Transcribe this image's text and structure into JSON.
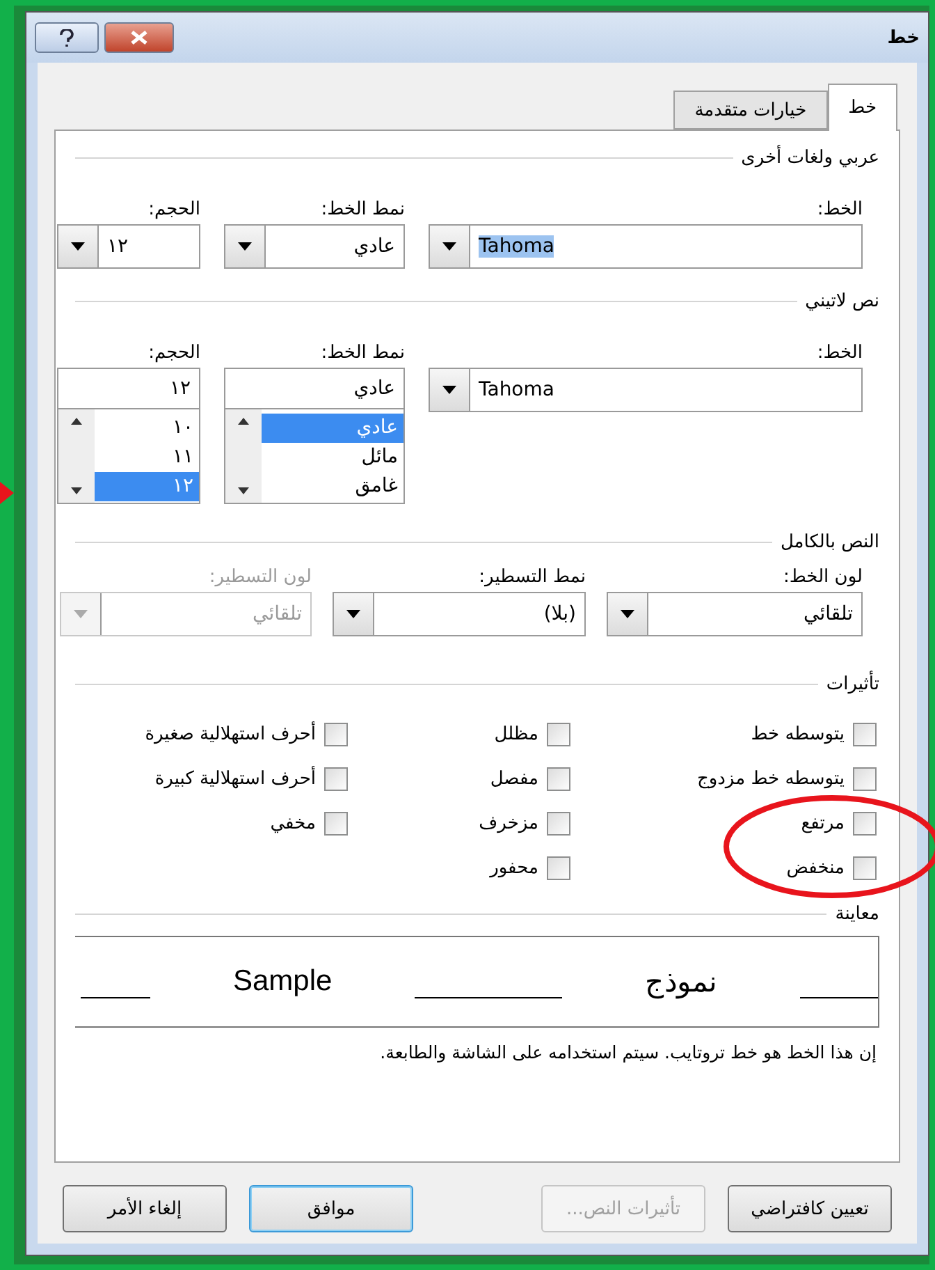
{
  "window": {
    "title": "خط"
  },
  "tabs": [
    {
      "label": "خط",
      "selected": true
    },
    {
      "label": "خيارات متقدمة",
      "selected": false
    }
  ],
  "arabic": {
    "heading": "عربي ولغات أخرى",
    "font_label": "الخط:",
    "font_value": "Tahoma",
    "font_value_highlighted": true,
    "style_label": "نمط الخط:",
    "style_value": "عادي",
    "size_label": "الحجم:",
    "size_value": "١٢"
  },
  "latin": {
    "heading": "نص لاتيني",
    "font_label": "الخط:",
    "font_value": "Tahoma",
    "style_label": "نمط الخط:",
    "style_value": "عادي",
    "style_options": [
      {
        "label": "عادي",
        "selected": true
      },
      {
        "label": "مائل",
        "selected": false
      },
      {
        "label": "غامق",
        "selected": false
      }
    ],
    "size_label": "الحجم:",
    "size_value": "١٢",
    "size_options": [
      {
        "label": "١٠",
        "selected": false
      },
      {
        "label": "١١",
        "selected": false
      },
      {
        "label": "١٢",
        "selected": true
      }
    ]
  },
  "all_text": {
    "heading": "النص بالكامل",
    "fields": [
      {
        "label": "لون الخط:",
        "value": "تلقائي",
        "disabled": false
      },
      {
        "label": "نمط التسطير:",
        "value": "(بلا)",
        "disabled": false
      },
      {
        "label": "لون التسطير:",
        "value": "تلقائي",
        "disabled": true
      }
    ]
  },
  "effects": {
    "heading": "تأثيرات",
    "columns": [
      [
        {
          "label": "يتوسطه خط",
          "checked": false
        },
        {
          "label": "يتوسطه خط مزدوج",
          "checked": false
        },
        {
          "label": "مرتفع",
          "checked": false
        },
        {
          "label": "منخفض",
          "checked": false
        }
      ],
      [
        {
          "label": "مظلل",
          "checked": false
        },
        {
          "label": "مفصل",
          "checked": false
        },
        {
          "label": "مزخرف",
          "checked": false
        },
        {
          "label": "محفور",
          "checked": false
        }
      ],
      [
        {
          "label": "أحرف استهلالية صغيرة",
          "checked": false
        },
        {
          "label": "أحرف استهلالية كبيرة",
          "checked": false
        },
        {
          "label": "مخفي",
          "checked": false
        }
      ]
    ]
  },
  "preview": {
    "heading": "معاينة",
    "arabic_sample": "نموذج",
    "latin_sample": "Sample",
    "note": "إن هذا الخط هو خط تروتايب. سيتم استخدامه على الشاشة والطابعة."
  },
  "buttons": [
    {
      "label": "تعيين كافتراضي",
      "disabled": false,
      "default": false
    },
    {
      "label": "تأثيرات النص...",
      "disabled": true,
      "default": false
    },
    {
      "label": "موافق",
      "disabled": false,
      "default": true
    },
    {
      "label": "إلغاء الأمر",
      "disabled": false,
      "default": false
    }
  ]
}
